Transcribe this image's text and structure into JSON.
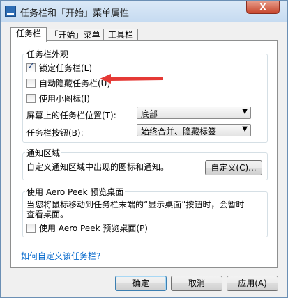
{
  "window": {
    "title": "任务栏和「开始」菜单属性",
    "close_label": "X"
  },
  "tabs": [
    {
      "label": "任务栏",
      "active": true
    },
    {
      "label": "「开始」菜单",
      "active": false
    },
    {
      "label": "工具栏",
      "active": false
    }
  ],
  "appearance": {
    "group_title": "任务栏外观",
    "lock_label": "锁定任务栏(L)",
    "lock_checked": true,
    "autohide_label": "自动隐藏任务栏(U)",
    "autohide_checked": false,
    "small_icons_label": "使用小图标(I)",
    "small_icons_checked": false,
    "location_label": "屏幕上的任务栏位置(T):",
    "location_value": "底部",
    "buttons_label": "任务栏按钮(B):",
    "buttons_value": "始终合并、隐藏标签"
  },
  "notification": {
    "group_title": "通知区域",
    "description": "自定义通知区域中出现的图标和通知。",
    "customize_button": "自定义(C)..."
  },
  "aero_peek": {
    "group_title": "使用 Aero Peek 预览桌面",
    "description_line1": "当您将鼠标移动到任务栏末端的“显示桌面”按钮时，会暂时",
    "description_line2": "查看桌面。",
    "checkbox_label": "使用 Aero Peek 预览桌面(P)",
    "checkbox_checked": false
  },
  "help_link": "如何自定义该任务栏?",
  "footer": {
    "ok": "确定",
    "cancel": "取消",
    "apply": "应用(A)"
  },
  "annotation_color": "#e53935"
}
